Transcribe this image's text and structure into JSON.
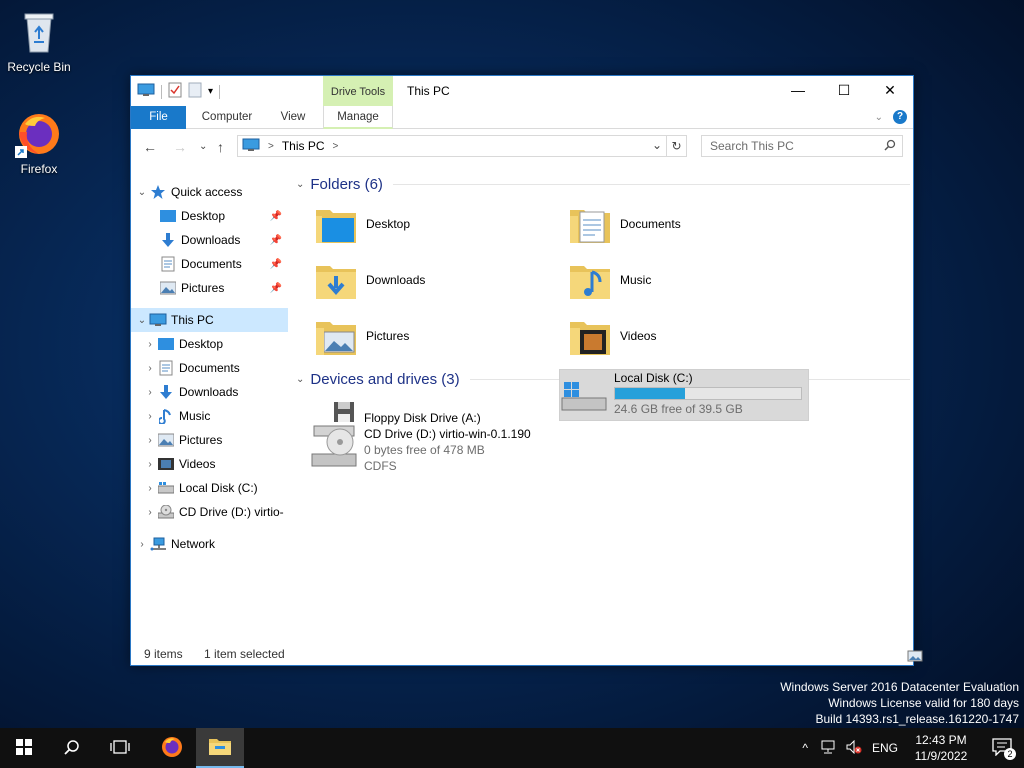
{
  "desktop": {
    "icons": [
      {
        "label": "Recycle Bin",
        "icon": "recycle-bin-icon"
      },
      {
        "label": "Firefox",
        "icon": "firefox-icon"
      }
    ],
    "watermark": {
      "line1": "Windows Server 2016 Datacenter Evaluation",
      "line2": "Windows License valid for 180 days",
      "line3": "Build 14393.rs1_release.161220-1747"
    }
  },
  "window": {
    "title": "This PC",
    "contextual_group": "Drive Tools",
    "tabs": [
      {
        "label": "File"
      },
      {
        "label": "Computer"
      },
      {
        "label": "View"
      },
      {
        "label": "Manage"
      }
    ],
    "address": {
      "location": "This PC",
      "separator": ">"
    },
    "search": {
      "placeholder": "Search This PC"
    },
    "nav": {
      "quick_access": {
        "label": "Quick access",
        "items": [
          {
            "label": "Desktop"
          },
          {
            "label": "Downloads"
          },
          {
            "label": "Documents"
          },
          {
            "label": "Pictures"
          }
        ]
      },
      "this_pc": {
        "label": "This PC",
        "items": [
          {
            "label": "Desktop"
          },
          {
            "label": "Documents"
          },
          {
            "label": "Downloads"
          },
          {
            "label": "Music"
          },
          {
            "label": "Pictures"
          },
          {
            "label": "Videos"
          },
          {
            "label": "Local Disk (C:)"
          },
          {
            "label": "CD Drive (D:) virtio-"
          }
        ]
      },
      "network": {
        "label": "Network"
      }
    },
    "folders": {
      "header": "Folders (6)",
      "items": [
        {
          "label": "Desktop"
        },
        {
          "label": "Documents"
        },
        {
          "label": "Downloads"
        },
        {
          "label": "Music"
        },
        {
          "label": "Pictures"
        },
        {
          "label": "Videos"
        }
      ]
    },
    "drives": {
      "header": "Devices and drives (3)",
      "floppy": {
        "label": "Floppy Disk Drive (A:)"
      },
      "local": {
        "label": "Local Disk (C:)",
        "free": "24.6 GB free of 39.5 GB",
        "used_fraction": 0.377
      },
      "cd": {
        "label": "CD Drive (D:) virtio-win-0.1.190",
        "free": "0 bytes free of 478 MB",
        "fs": "CDFS"
      }
    },
    "status": {
      "items": "9 items",
      "selected": "1 item selected"
    }
  },
  "taskbar": {
    "lang": "ENG",
    "time": "12:43 PM",
    "date": "11/9/2022",
    "notifications": "2"
  },
  "colors": {
    "accent": "#1979ca",
    "selection": "#cce8ff",
    "progress": "#26a0da",
    "manage_tab": "#d5f0b3"
  }
}
